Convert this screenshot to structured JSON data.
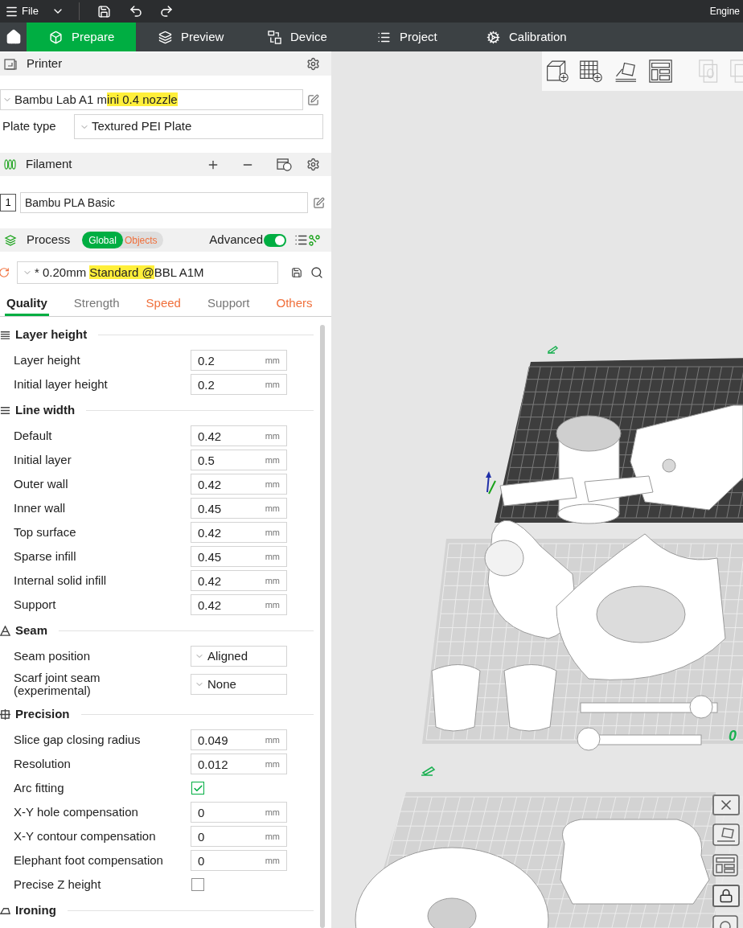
{
  "toolbar": {
    "menu_label": "File",
    "engine_label": "Engine"
  },
  "main_tabs": [
    {
      "label": "Prepare",
      "selected": true
    },
    {
      "label": "Preview",
      "selected": false
    },
    {
      "label": "Device",
      "selected": false
    },
    {
      "label": "Project",
      "selected": false
    },
    {
      "label": "Calibration",
      "selected": false
    }
  ],
  "printer": {
    "title": "Printer",
    "preset": [
      {
        "text": "Bambu Lab A1 m",
        "highlighted": false
      },
      {
        "text": "ini 0.4 nozzle",
        "highlighted": true
      }
    ],
    "plate_type_label": "Plate type",
    "plate_type": "Textured PEI Plate"
  },
  "filament": {
    "title": "Filament",
    "slots": [
      {
        "index": "1",
        "name": "Bambu PLA Basic"
      }
    ]
  },
  "process": {
    "title": "Process",
    "scope": [
      {
        "label": "Global",
        "selected": true,
        "modified": false
      },
      {
        "label": "Objects",
        "selected": false,
        "modified": true
      }
    ],
    "advanced_label": "Advanced",
    "advanced_on": true,
    "preset": [
      {
        "text": "* 0.20mm ",
        "highlighted": false
      },
      {
        "text": "Standard @",
        "highlighted": true
      },
      {
        "text": "BBL A1M",
        "highlighted": false
      }
    ],
    "tabs": [
      {
        "label": "Quality",
        "selected": true,
        "modified": false
      },
      {
        "label": "Strength",
        "selected": false,
        "modified": false
      },
      {
        "label": "Speed",
        "selected": false,
        "modified": true
      },
      {
        "label": "Support",
        "selected": false,
        "modified": false
      },
      {
        "label": "Others",
        "selected": false,
        "modified": true
      }
    ]
  },
  "settings": [
    {
      "title": "Layer height",
      "rows": [
        {
          "kind": "number",
          "label": "Layer height",
          "value": "0.2",
          "unit": "mm"
        },
        {
          "kind": "number",
          "label": "Initial layer height",
          "value": "0.2",
          "unit": "mm"
        }
      ]
    },
    {
      "title": "Line width",
      "rows": [
        {
          "kind": "number",
          "label": "Default",
          "value": "0.42",
          "unit": "mm"
        },
        {
          "kind": "number",
          "label": "Initial layer",
          "value": "0.5",
          "unit": "mm"
        },
        {
          "kind": "number",
          "label": "Outer wall",
          "value": "0.42",
          "unit": "mm"
        },
        {
          "kind": "number",
          "label": "Inner wall",
          "value": "0.45",
          "unit": "mm"
        },
        {
          "kind": "number",
          "label": "Top surface",
          "value": "0.42",
          "unit": "mm"
        },
        {
          "kind": "number",
          "label": "Sparse infill",
          "value": "0.45",
          "unit": "mm"
        },
        {
          "kind": "number",
          "label": "Internal solid infill",
          "value": "0.42",
          "unit": "mm"
        },
        {
          "kind": "number",
          "label": "Support",
          "value": "0.42",
          "unit": "mm"
        }
      ]
    },
    {
      "title": "Seam",
      "rows": [
        {
          "kind": "dropdown",
          "label": "Seam position",
          "value": "Aligned"
        },
        {
          "kind": "dropdown",
          "label": "Scarf joint seam (experimental)",
          "value": "None"
        }
      ]
    },
    {
      "title": "Precision",
      "rows": [
        {
          "kind": "number",
          "label": "Slice gap closing radius",
          "value": "0.049",
          "unit": "mm"
        },
        {
          "kind": "number",
          "label": "Resolution",
          "value": "0.012",
          "unit": "mm"
        },
        {
          "kind": "checkbox",
          "label": "Arc fitting",
          "checked": true
        },
        {
          "kind": "number",
          "label": "X-Y hole compensation",
          "value": "0",
          "unit": "mm"
        },
        {
          "kind": "number",
          "label": "X-Y contour compensation",
          "value": "0",
          "unit": "mm"
        },
        {
          "kind": "number",
          "label": "Elephant foot compensation",
          "value": "0",
          "unit": "mm"
        },
        {
          "kind": "checkbox",
          "label": "Precise Z height",
          "checked": false
        }
      ]
    },
    {
      "title": "Ironing"
    }
  ],
  "viewport": {
    "plate_number": "0"
  }
}
